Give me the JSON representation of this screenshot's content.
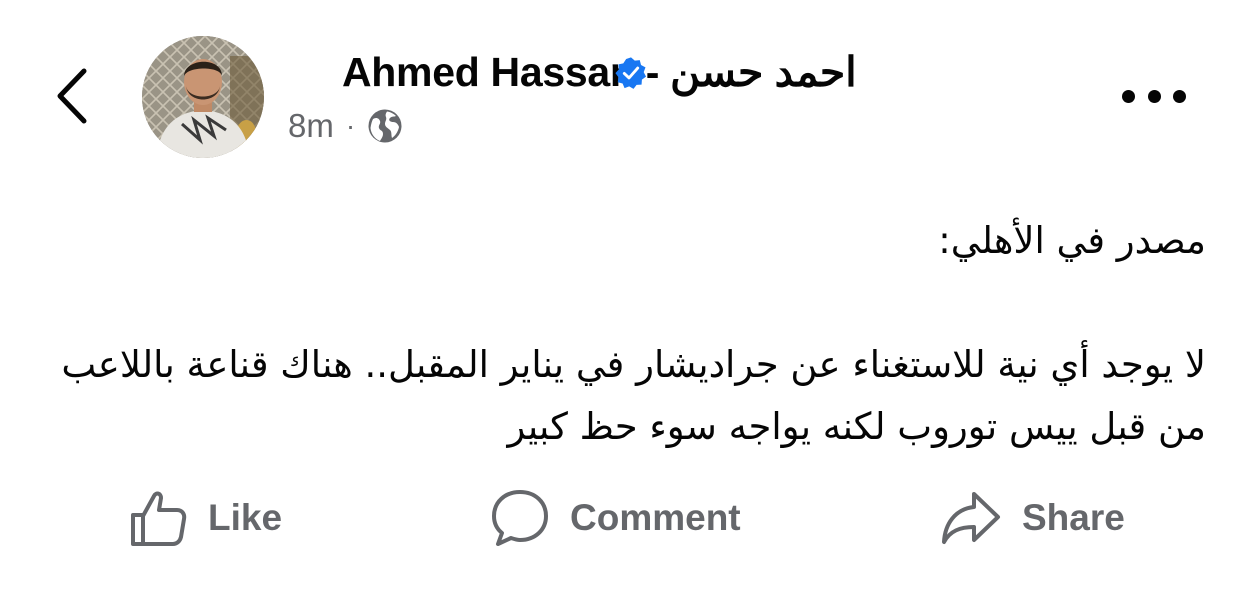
{
  "header": {
    "author_name": "Ahmed Hassan - احمد حسن",
    "timestamp": "8m",
    "separator": "·",
    "audience_icon": "globe-icon",
    "verified_icon": "verified-badge-icon",
    "back_icon": "chevron-left-icon",
    "more_icon": "more-horizontal-icon"
  },
  "post": {
    "lines": [
      "مصدر في الأهلي:",
      "",
      "لا يوجد أي نية للاستغناء عن جراديشار في يناير المقبل.. هناك قناعة باللاعب من قبل ييس توروب لكنه يواجه سوء حظ كبير"
    ]
  },
  "actions": {
    "like_label": "Like",
    "comment_label": "Comment",
    "share_label": "Share",
    "like_icon": "thumbs-up-icon",
    "comment_icon": "comment-bubble-icon",
    "share_icon": "share-arrow-icon"
  },
  "colors": {
    "text_primary": "#050505",
    "text_secondary": "#65676b",
    "verified_blue": "#1877f2",
    "background": "#ffffff"
  }
}
